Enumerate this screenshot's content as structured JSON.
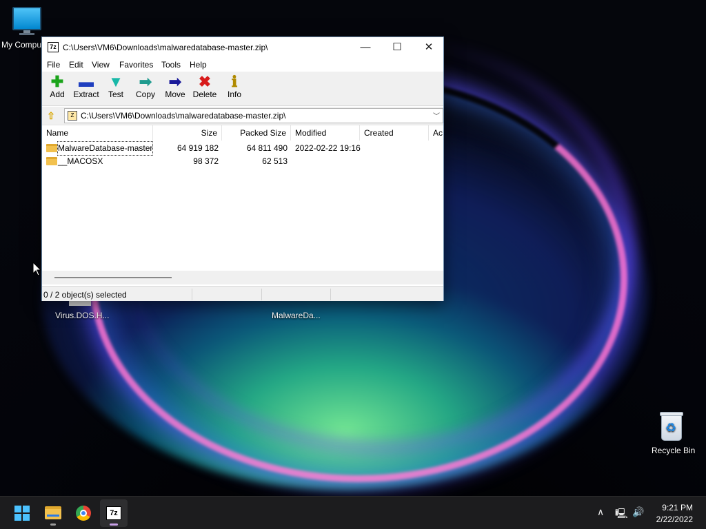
{
  "desktop": {
    "icons": {
      "my_computer": "My Computer",
      "virus_dos": "Virus.DOS.H...",
      "malwareda": "MalwareDa...",
      "recycle_bin": "Recycle Bin"
    }
  },
  "window": {
    "title": "C:\\Users\\VM6\\Downloads\\malwaredatabase-master.zip\\",
    "app_icon": "7z",
    "controls": {
      "minimize": "—",
      "maximize": "☐",
      "close": "✕"
    },
    "menu": [
      "File",
      "Edit",
      "View",
      "Favorites",
      "Tools",
      "Help"
    ],
    "toolbar": [
      {
        "label": "Add",
        "icon": "add-icon",
        "glyph": "✚",
        "color": "#1aa31a"
      },
      {
        "label": "Extract",
        "icon": "extract-icon",
        "glyph": "▬",
        "color": "#1f3fbf"
      },
      {
        "label": "Test",
        "icon": "test-icon",
        "glyph": "▼",
        "color": "#19b8a8"
      },
      {
        "label": "Copy",
        "icon": "copy-icon",
        "glyph": "➡",
        "color": "#1f9b8f"
      },
      {
        "label": "Move",
        "icon": "move-icon",
        "glyph": "➡",
        "color": "#1a1a9a"
      },
      {
        "label": "Delete",
        "icon": "delete-icon",
        "glyph": "✖",
        "color": "#d81b1b"
      },
      {
        "label": "Info",
        "icon": "info-icon",
        "glyph": "ℹ",
        "color": "#b08a00"
      }
    ],
    "address": {
      "path": "C:\\Users\\VM6\\Downloads\\malwaredatabase-master.zip\\",
      "icon_glyph": "Z"
    },
    "columns": [
      "Name",
      "Size",
      "Packed Size",
      "Modified",
      "Created",
      "Ac"
    ],
    "rows": [
      {
        "name": "MalwareDatabase-master",
        "size": "64 919 182",
        "packed": "64 811 490",
        "modified": "2022-02-22 19:16",
        "created": ""
      },
      {
        "name": "__MACOSX",
        "size": "98 372",
        "packed": "62 513",
        "modified": "",
        "created": ""
      }
    ],
    "status": "0 / 2 object(s) selected"
  },
  "taskbar": {
    "apps": [
      "start",
      "file-explorer",
      "chrome",
      "7-zip"
    ],
    "tray": {
      "chevron": "∧",
      "network": "🖳",
      "volume": "🔊"
    },
    "time": "9:21 PM",
    "date": "2/22/2022"
  }
}
